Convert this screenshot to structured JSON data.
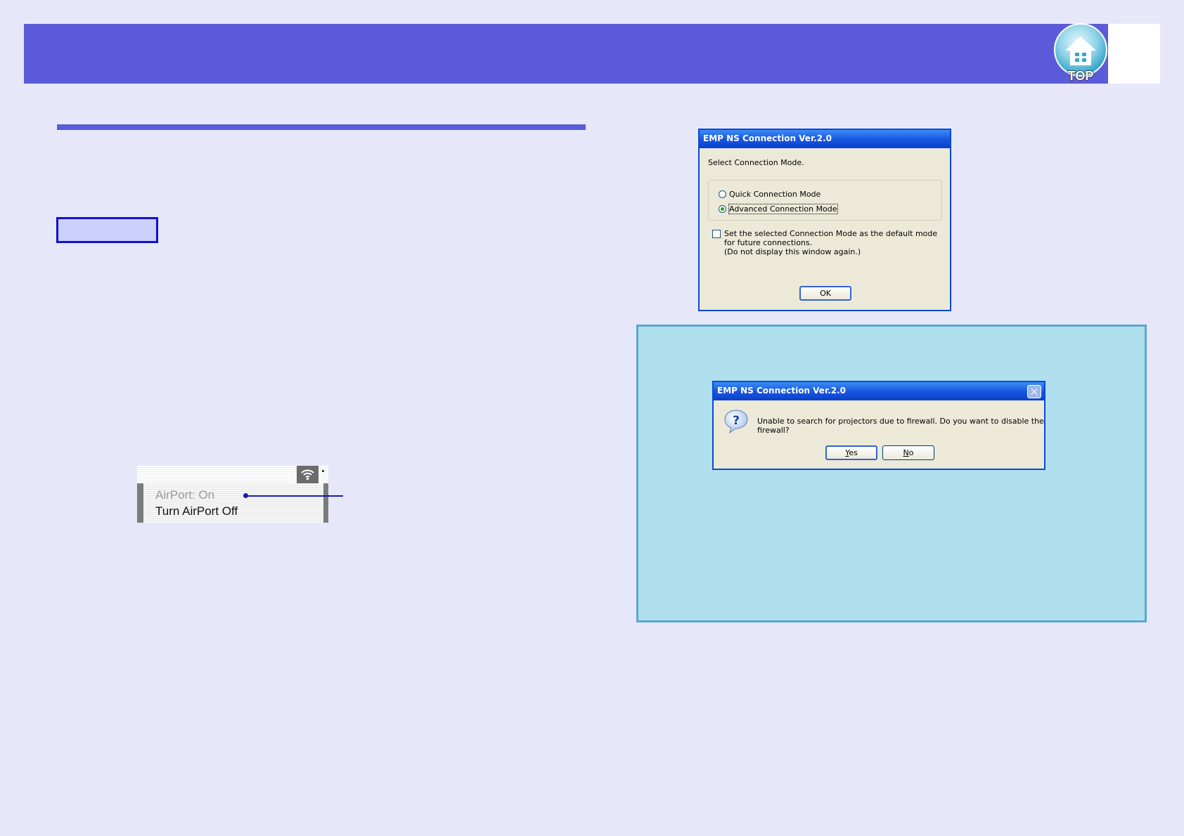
{
  "header": {
    "logo_icon": "house-icon",
    "logo_text": "TOP",
    "band_color": "#5b5bd9"
  },
  "airport_menu": {
    "status_item": "AirPort: On",
    "toggle_item": "Turn AirPort Off",
    "menubar_icon": "wifi-icon"
  },
  "dialog_connection_mode": {
    "title": "EMP NS Connection Ver.2.0",
    "prompt": "Select Connection Mode.",
    "options": [
      {
        "label": "Quick Connection Mode",
        "selected": false
      },
      {
        "label": "Advanced Connection Mode",
        "selected": true
      }
    ],
    "default_checkbox_label": "Set the selected Connection Mode as the default mode for future connections.",
    "default_checkbox_note": "(Do not display this window again.)",
    "default_checkbox_checked": false,
    "ok_button": "OK"
  },
  "dialog_firewall": {
    "title": "EMP NS Connection Ver.2.0",
    "icon": "question-icon",
    "message": "Unable to search for projectors due to firewall. Do you want to disable the firewall?",
    "yes_accel": "Y",
    "yes_rest": "es",
    "no_accel": "N",
    "no_rest": "o"
  },
  "colors": {
    "page_background": "#e6e8fa",
    "accent": "#5b5bd9",
    "procedure_box_border": "#1010d0",
    "note_background": "#b0e0ee",
    "note_border": "#5ba6d1"
  }
}
